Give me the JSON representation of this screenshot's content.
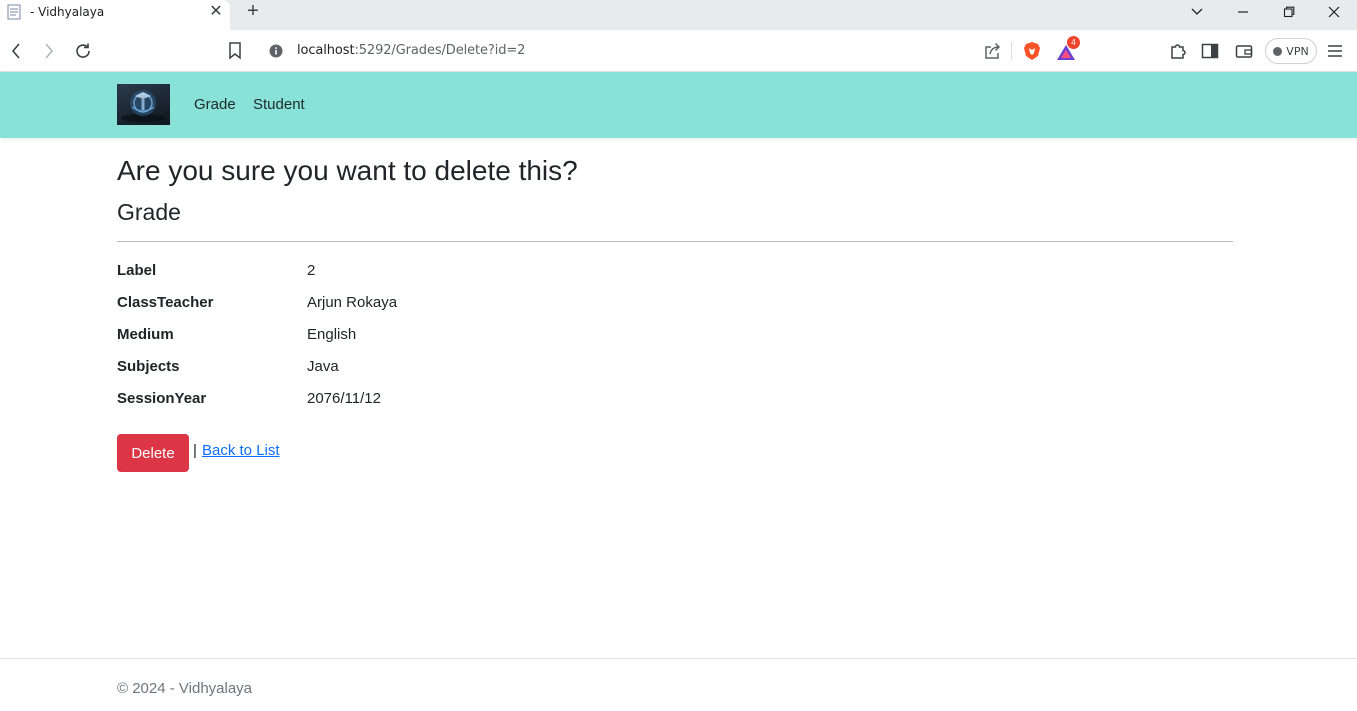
{
  "browser": {
    "tab_title": "- Vidhyalaya",
    "url_host": "localhost",
    "url_path": ":5292/Grades/Delete?id=2",
    "brave_rewards_count": "4",
    "vpn_label": "VPN"
  },
  "site": {
    "nav": {
      "links": [
        "Grade",
        "Student"
      ]
    },
    "page": {
      "heading": "Are you sure you want to delete this?",
      "subheading": "Grade",
      "fields": [
        {
          "label": "Label",
          "value": "2"
        },
        {
          "label": "ClassTeacher",
          "value": "Arjun Rokaya"
        },
        {
          "label": "Medium",
          "value": "English"
        },
        {
          "label": "Subjects",
          "value": "Java"
        },
        {
          "label": "SessionYear",
          "value": "2076/11/12"
        }
      ],
      "delete_label": "Delete",
      "separator": "|",
      "back_label": "Back to List"
    },
    "footer": "© 2024 - Vidhyalaya"
  },
  "colors": {
    "navbar_bg": "#88e2d7",
    "delete_bg": "#dc3545",
    "link": "#0d6efd"
  }
}
